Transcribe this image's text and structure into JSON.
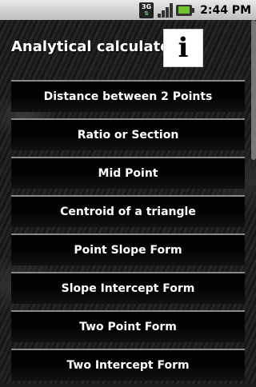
{
  "status_bar": {
    "network": "3G",
    "time": "2:44 PM"
  },
  "header": {
    "title": "Analytical calculator",
    "info_glyph": "i"
  },
  "menu": {
    "items": [
      {
        "label": "Distance between 2 Points"
      },
      {
        "label": "Ratio or Section"
      },
      {
        "label": "Mid Point"
      },
      {
        "label": "Centroid of a triangle"
      },
      {
        "label": "Point Slope Form"
      },
      {
        "label": "Slope Intercept Form"
      },
      {
        "label": "Two Point Form"
      },
      {
        "label": "Two Intercept Form"
      }
    ]
  },
  "colors": {
    "battery": "#6fc32f",
    "button_border": "#8a8a8a"
  }
}
